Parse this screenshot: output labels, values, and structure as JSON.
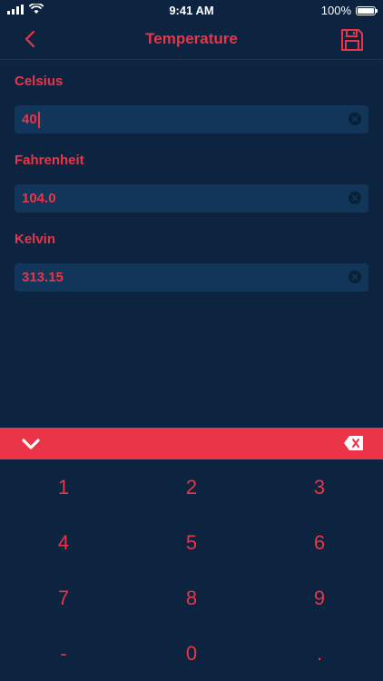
{
  "status_bar": {
    "time": "9:41 AM",
    "battery": "100%",
    "battery_level": 1.0
  },
  "nav": {
    "title": "Temperature",
    "back_icon": "chevron-left-icon",
    "save_icon": "floppy-disk-icon"
  },
  "fields": [
    {
      "label": "Celsius",
      "value": "40",
      "focused": true
    },
    {
      "label": "Fahrenheit",
      "value": "104.0",
      "focused": false
    },
    {
      "label": "Kelvin",
      "value": "313.15",
      "focused": false
    }
  ],
  "keyboard": {
    "hide_icon": "chevron-down-icon",
    "backspace_icon": "backspace-icon",
    "keys": [
      [
        "1",
        "2",
        "3"
      ],
      [
        "4",
        "5",
        "6"
      ],
      [
        "7",
        "8",
        "9"
      ],
      [
        "-",
        "0",
        "."
      ]
    ]
  },
  "colors": {
    "background": "#0d2440",
    "accent": "#ea3448",
    "field_background": "#12365a"
  }
}
